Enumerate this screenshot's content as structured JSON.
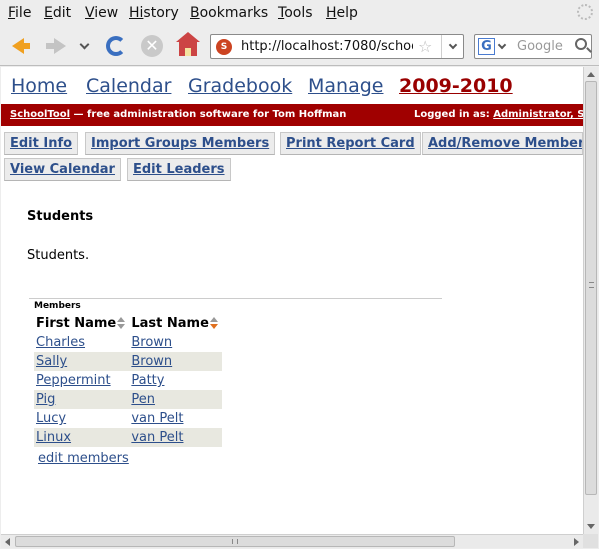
{
  "menubar": {
    "items": [
      {
        "key": "F",
        "rest": "ile"
      },
      {
        "key": "E",
        "rest": "dit"
      },
      {
        "key": "V",
        "rest": "iew"
      },
      {
        "key": "Hi",
        "rest": "story",
        "underline_index": 1
      },
      {
        "key": "B",
        "rest": "ookmarks"
      },
      {
        "key": "T",
        "rest": "ools"
      },
      {
        "key": "H",
        "rest": "elp"
      }
    ]
  },
  "navbar": {
    "url": "http://localhost:7080/schoo",
    "search_placeholder": "Google",
    "search_engine_letter": "G"
  },
  "page": {
    "topnav": [
      "Home",
      "Calendar",
      "Gradebook",
      "Manage",
      "2009-2010"
    ],
    "redbar": {
      "brand": "SchoolTool",
      "tagline": " — free administration software for Tom Hoffman",
      "logged_in_label": "Logged in as: ",
      "user": "Administrator, S"
    },
    "actions_row1": [
      "Edit Info",
      "Import Groups Members",
      "Print Report Card",
      "Add/Remove Members"
    ],
    "actions_row2": [
      "View Calendar",
      "Edit Leaders"
    ],
    "heading": "Students",
    "description": "Students.",
    "members": {
      "caption": "Members",
      "columns": [
        "First Name",
        "Last Name"
      ],
      "rows": [
        {
          "first": "Charles",
          "last": "Brown"
        },
        {
          "first": "Sally",
          "last": "Brown"
        },
        {
          "first": "Peppermint",
          "last": "Patty"
        },
        {
          "first": "Pig",
          "last": "Pen"
        },
        {
          "first": "Lucy",
          "last": "van Pelt"
        },
        {
          "first": "Linux",
          "last": "van Pelt"
        }
      ],
      "edit_link": "edit members"
    }
  },
  "colors": {
    "link": "#2d4f8b",
    "active_year": "#990000",
    "redbar": "#a00000",
    "sort_active": "#e0701f"
  }
}
